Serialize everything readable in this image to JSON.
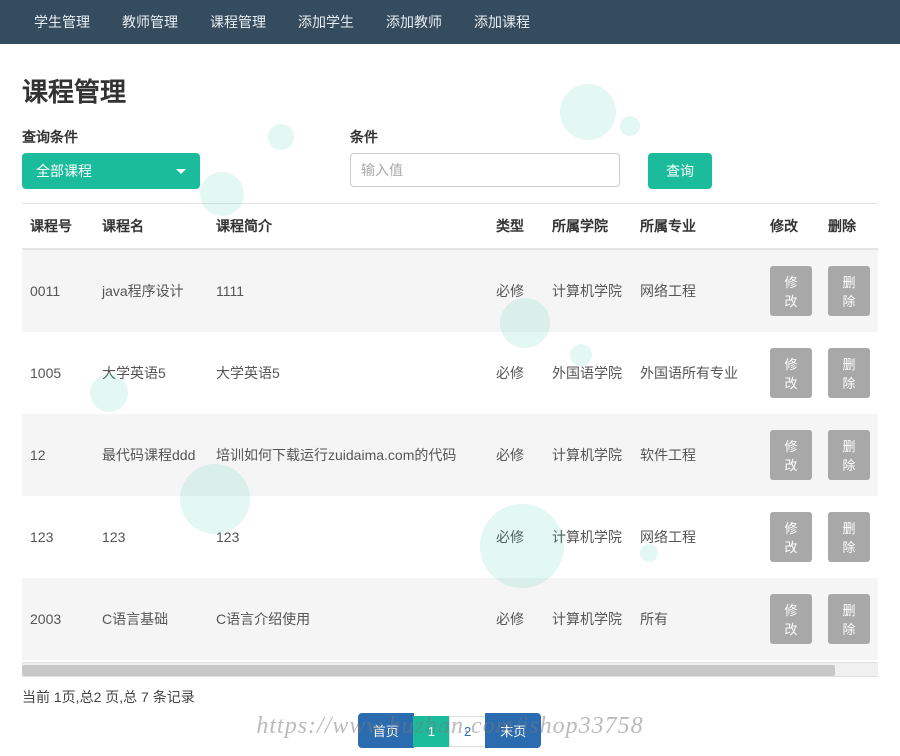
{
  "nav": {
    "items": [
      "学生管理",
      "教师管理",
      "课程管理",
      "添加学生",
      "添加教师",
      "添加课程"
    ]
  },
  "page": {
    "title": "课程管理"
  },
  "filter": {
    "query_label": "查询条件",
    "dropdown_selected": "全部课程",
    "condition_label": "条件",
    "input_placeholder": "输入值",
    "search_button": "查询"
  },
  "table": {
    "headers": {
      "id": "课程号",
      "name": "课程名",
      "desc": "课程简介",
      "type": "类型",
      "college": "所属学院",
      "major": "所属专业",
      "edit": "修改",
      "delete": "删除"
    },
    "edit_btn": "修改",
    "delete_btn": "删除",
    "rows": [
      {
        "id": "0011",
        "name": "java程序设计",
        "desc": "1111",
        "type": "必修",
        "college": "计算机学院",
        "major": "网络工程"
      },
      {
        "id": "1005",
        "name": "大学英语5",
        "desc": "大学英语5",
        "type": "必修",
        "college": "外国语学院",
        "major": "外国语所有专业"
      },
      {
        "id": "12",
        "name": "最代码课程ddd",
        "desc": "培训如何下载运行zuidaima.com的代码",
        "type": "必修",
        "college": "计算机学院",
        "major": "软件工程"
      },
      {
        "id": "123",
        "name": "123",
        "desc": "123",
        "type": "必修",
        "college": "计算机学院",
        "major": "网络工程"
      },
      {
        "id": "2003",
        "name": "C语言基础",
        "desc": "C语言介绍使用",
        "type": "必修",
        "college": "计算机学院",
        "major": "所有"
      }
    ]
  },
  "pagination": {
    "info": "当前 1页,总2 页,总 7 条记录",
    "first": "首页",
    "current": "1",
    "page2": "2",
    "last": "末页"
  },
  "watermark": "https://www.huzhan.com/ishop33758"
}
